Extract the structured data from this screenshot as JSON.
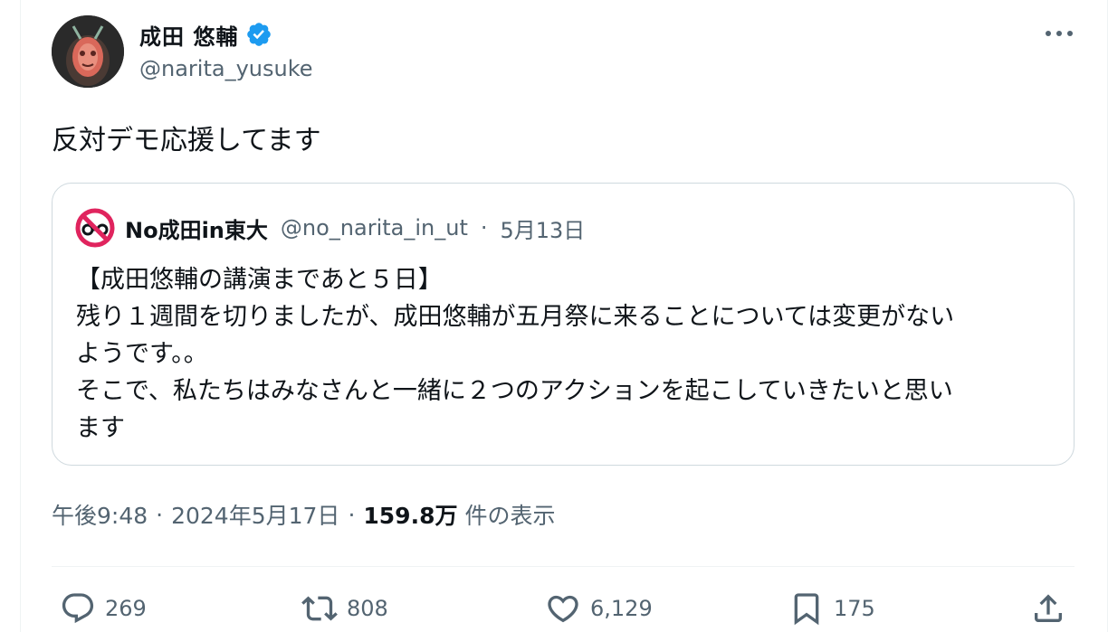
{
  "author": {
    "name": "成田 悠輔",
    "handle": "@narita_yusuke",
    "verified": true
  },
  "tweet": {
    "text": "反対デモ応援してます"
  },
  "quote": {
    "name": "No成田in東大",
    "handle": "@no_narita_in_ut",
    "separator": "·",
    "date": "5月13日",
    "lines": [
      "【成田悠輔の講演まであと５日】",
      "残り１週間を切りましたが、成田悠輔が五月祭に来ることについては変更がない",
      "ようです。。",
      "そこで、私たちはみなさんと一緒に２つのアクションを起こしていきたいと思い",
      "ます"
    ]
  },
  "meta": {
    "time": "午後9:48",
    "separator": "·",
    "date": "2024年5月17日",
    "views": "159.8万",
    "views_label": "件の表示"
  },
  "actions": {
    "reply_count": "269",
    "retweet_count": "808",
    "like_count": "6,129",
    "bookmark_count": "175"
  },
  "colors": {
    "text_primary": "#0f1419",
    "text_secondary": "#536471",
    "verified_blue": "#1d9bf0",
    "border": "#cfd9de",
    "no_sign_red": "#e0245e"
  },
  "icons": {
    "avatar": "avatar-image",
    "verified": "verified-badge-icon",
    "more": "more-horizontal-icon",
    "reply": "reply-icon",
    "retweet": "retweet-icon",
    "like": "like-heart-icon",
    "bookmark": "bookmark-icon",
    "share": "share-icon"
  }
}
